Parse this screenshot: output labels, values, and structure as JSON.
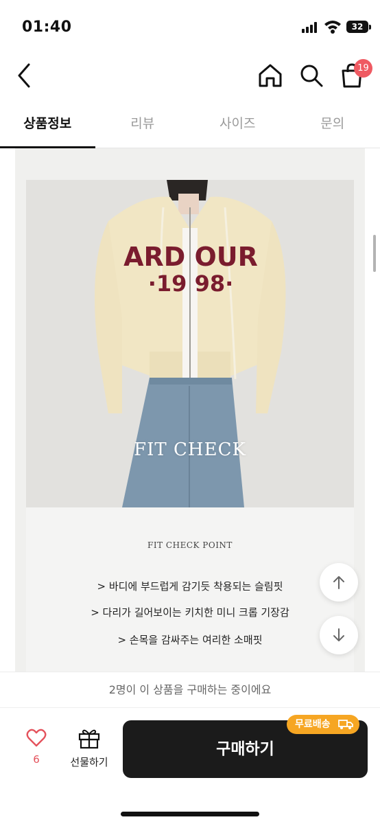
{
  "status_bar": {
    "time": "01:40",
    "battery": "32"
  },
  "nav": {
    "cart_count": "19"
  },
  "tabs": [
    {
      "label": "상품정보",
      "active": true
    },
    {
      "label": "리뷰",
      "active": false
    },
    {
      "label": "사이즈",
      "active": false
    },
    {
      "label": "문의",
      "active": false
    }
  ],
  "product_image": {
    "overlay_text": "FIT CHECK",
    "sweater_text_top": "ARD OUR",
    "sweater_text_bottom": "·19 98·"
  },
  "fit_check": {
    "title": "FIT CHECK POINT",
    "points": [
      "> 바디에 부드럽게 감기듯 착용되는 슬림핏",
      "> 다리가 길어보이는 키치한 미니 크롭 기장감",
      "> 손목을 감싸주는 여리한 소매핏"
    ]
  },
  "notice": "2명이 이 상품을 구매하는 중이에요",
  "bottom_bar": {
    "like_count": "6",
    "gift_label": "선물하기",
    "buy_label": "구매하기",
    "free_shipping_label": "무료배송"
  },
  "colors": {
    "accent_badge": "#ef5a62",
    "free_shipping": "#f6a623",
    "buy_button": "#1b1b1b",
    "like": "#e4525c"
  }
}
